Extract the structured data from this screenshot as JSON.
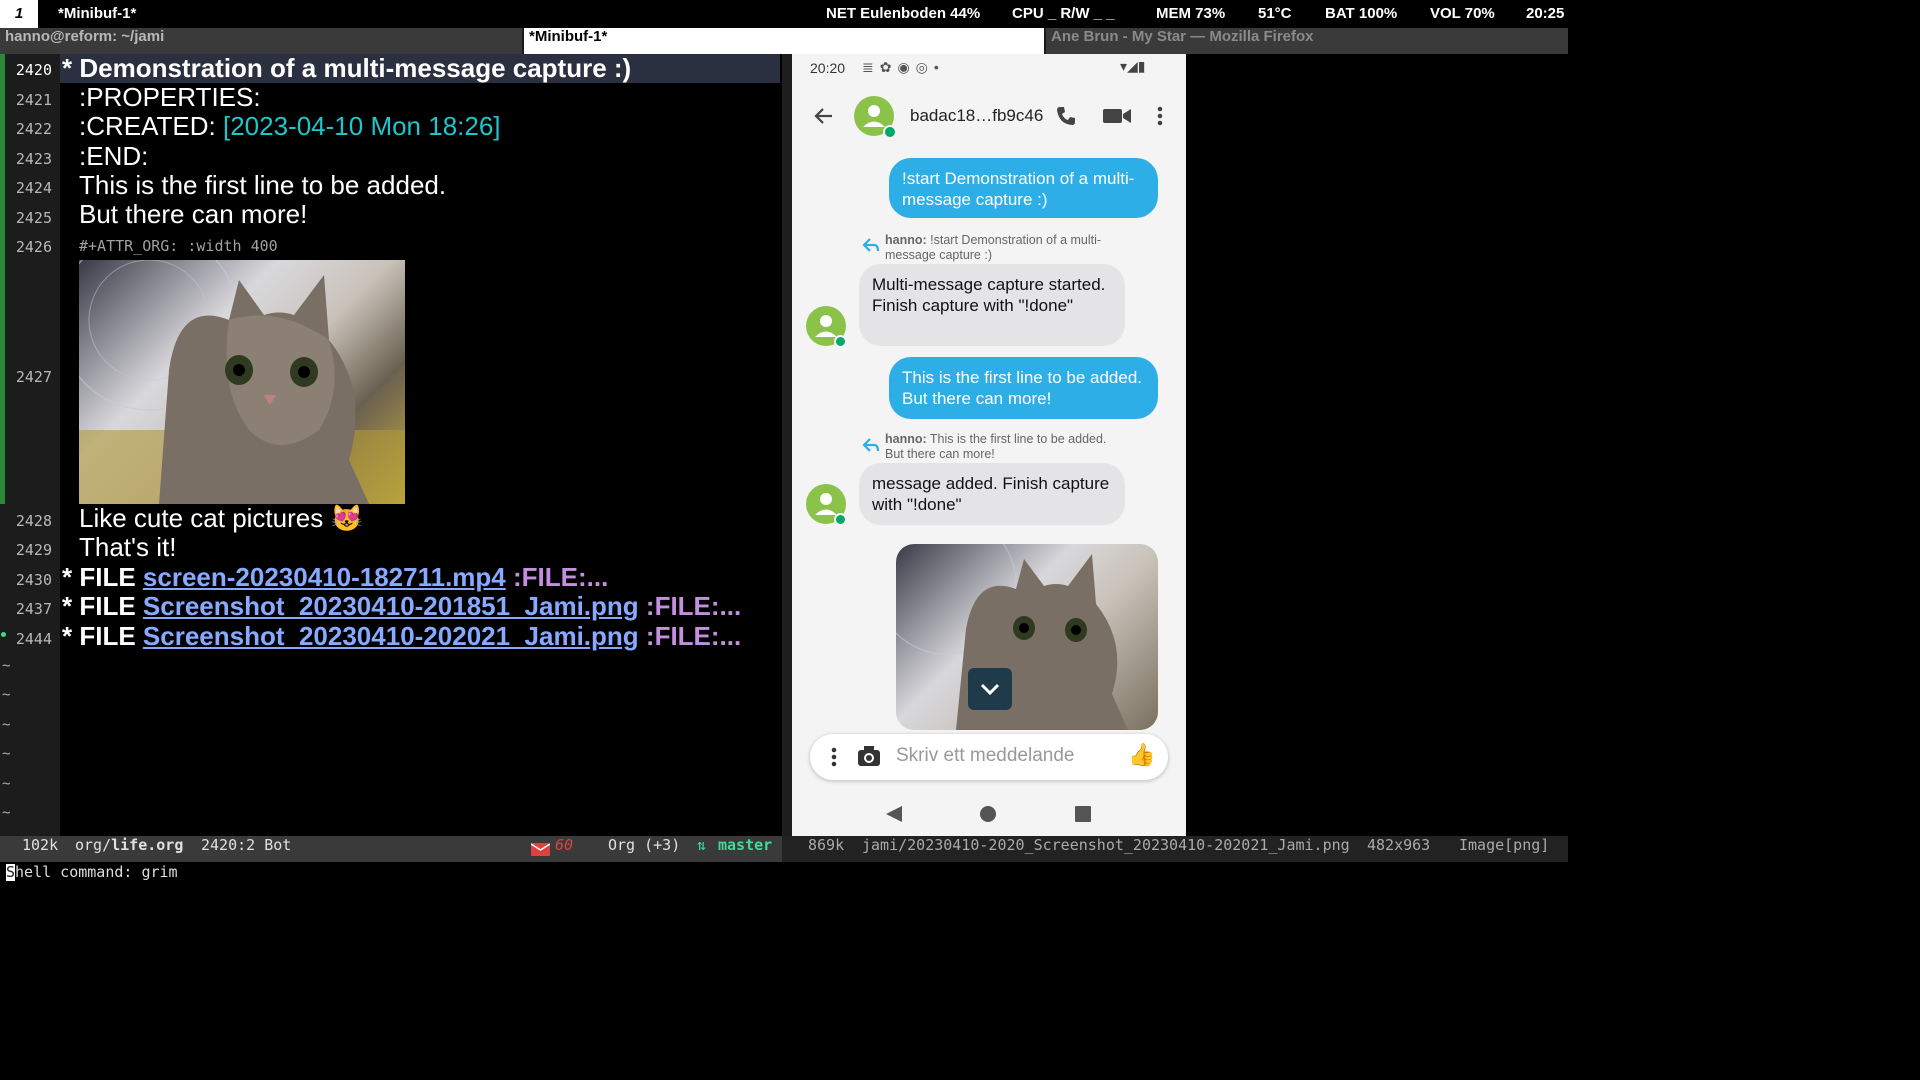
{
  "topbar": {
    "workspace": "1",
    "window_title": "*Minibuf-1*",
    "stats": [
      "NET Eulenboden 44%",
      "CPU _ R/W _ _",
      "MEM 73%",
      "51°C",
      "BAT 100%",
      "VOL 70%",
      "20:25"
    ]
  },
  "tabs": [
    "hanno@reform: ~/jami",
    "*Minibuf-1*",
    "Ane Brun - My Star — Mozilla Firefox"
  ],
  "emacs": {
    "line_numbers": [
      "2420",
      "2421",
      "2422",
      "2423",
      "2424",
      "2425",
      "2426",
      "2427",
      "2428",
      "2429",
      "2430",
      "2437",
      "2444"
    ],
    "heading": "* Demonstration of a multi-message capture :)",
    "props_start": ":PROPERTIES:",
    "created_key": ":CREATED:",
    "created_val": "[2023-04-10 Mon 18:26]",
    "props_end": ":END:",
    "body1": "This is the first line to be added.",
    "body2": "But there can more!",
    "attr": "#+ATTR_ORG: :width 400",
    "body3": "Like cute cat pictures 😻",
    "body4": "That's it!",
    "files": [
      {
        "star": "* FILE",
        "link": "screen-20230410-182711.mp4",
        "tag": ":FILE:..."
      },
      {
        "star": "* FILE",
        "link": "Screenshot_20230410-201851_Jami.png",
        "tag": ":FILE:..."
      },
      {
        "star": "* FILE",
        "link": "Screenshot_20230410-202021_Jami.png",
        "tag": ":FILE:..."
      }
    ],
    "tilde": "~"
  },
  "modeline_left": {
    "size": "102k",
    "path_dir": "org/",
    "path_file": "life.org",
    "position": "2420:2 Bot",
    "mail_count": "60",
    "mode": "Org (+3)",
    "branch": "master"
  },
  "modeline_right": {
    "size": "869k",
    "path": "jami/20230410-2020_Screenshot_20230410-202021_Jami.png",
    "dims": "482x963",
    "mode": "Image[png]"
  },
  "echo": "Shell command: grim",
  "phone": {
    "time": "20:20",
    "contact": "badac18…fb9c46",
    "messages": {
      "out1": "!start Demonstration of a multi-message capture :)",
      "reply1_name": "hanno:",
      "reply1_text": "!start Demonstration of a multi-message capture :)",
      "in1": "Multi-message capture started. Finish capture with \"!done\"",
      "out2": "This is the first line to be added. But there can more!",
      "reply2_name": "hanno:",
      "reply2_text": "This is the first line to be added. But there can more!",
      "in2": "message added. Finish capture with \"!done\""
    },
    "input_placeholder": "Skriv ett meddelande",
    "colors": {
      "accent": "#2eaee6",
      "avatar": "#8bc34a"
    }
  }
}
